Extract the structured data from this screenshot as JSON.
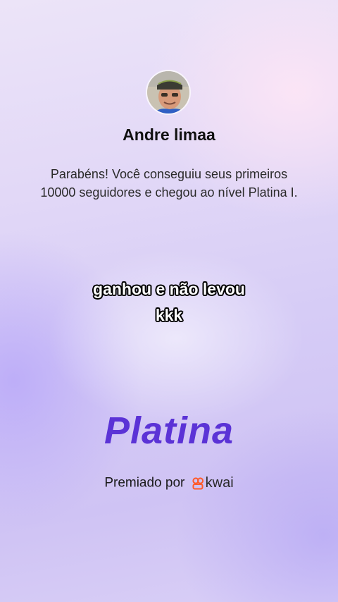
{
  "user": {
    "name": "Andre limaa",
    "avatar_icon": "profile-photo"
  },
  "message": {
    "text": "Parabéns! Você conseguiu seus primeiros 10000 seguidores e chegou ao nível Platina I."
  },
  "caption": {
    "line1": "ganhou e não levou",
    "line2": "kkk"
  },
  "tier": {
    "name": "Platina",
    "color": "#5b33d6"
  },
  "awarded": {
    "label": "Premiado por",
    "brand": "kwai",
    "brand_icon": "kwai-logo-icon",
    "brand_color": "#ff5a2a"
  }
}
